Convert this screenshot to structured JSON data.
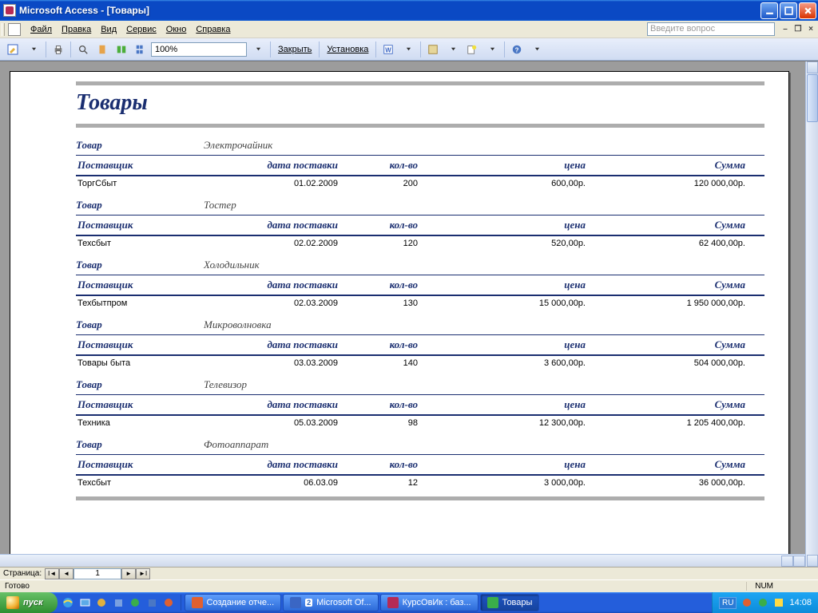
{
  "window": {
    "title": "Microsoft Access - [Товары]"
  },
  "menu": {
    "items": [
      "Файл",
      "Правка",
      "Вид",
      "Сервис",
      "Окно",
      "Справка"
    ],
    "question_placeholder": "Введите вопрос"
  },
  "toolbar": {
    "zoom": "100%",
    "close": "Закрыть",
    "setup": "Установка"
  },
  "navbar": {
    "label": "Страница:",
    "value": "1"
  },
  "status": {
    "ready": "Готово",
    "num": "NUM"
  },
  "report": {
    "title": "Товары",
    "group_label": "Товар",
    "headers": {
      "supplier": "Поставщик",
      "date": "дата поставки",
      "qty": "кол-во",
      "price": "цена",
      "sum": "Сумма"
    },
    "groups": [
      {
        "name": "Электрочайник",
        "rows": [
          {
            "supplier": "ТоргСбыт",
            "date": "01.02.2009",
            "qty": "200",
            "price": "600,00р.",
            "sum": "120 000,00р."
          }
        ]
      },
      {
        "name": "Тостер",
        "rows": [
          {
            "supplier": "Техсбыт",
            "date": "02.02.2009",
            "qty": "120",
            "price": "520,00р.",
            "sum": "62 400,00р."
          }
        ]
      },
      {
        "name": "Холодильник",
        "rows": [
          {
            "supplier": "Техбытпром",
            "date": "02.03.2009",
            "qty": "130",
            "price": "15 000,00р.",
            "sum": "1 950 000,00р."
          }
        ]
      },
      {
        "name": "Микроволновка",
        "rows": [
          {
            "supplier": "Товары быта",
            "date": "03.03.2009",
            "qty": "140",
            "price": "3 600,00р.",
            "sum": "504 000,00р."
          }
        ]
      },
      {
        "name": "Телевизор",
        "rows": [
          {
            "supplier": "Техника",
            "date": "05.03.2009",
            "qty": "98",
            "price": "12 300,00р.",
            "sum": "1 205 400,00р."
          }
        ]
      },
      {
        "name": "Фотоаппарат",
        "rows": [
          {
            "supplier": "Техсбыт",
            "date": "06.03.09",
            "qty": "12",
            "price": "3 000,00р.",
            "sum": "36 000,00р."
          }
        ]
      }
    ]
  },
  "taskbar": {
    "start": "пуск",
    "tasks": [
      {
        "label": "Создание отче...",
        "active": false,
        "color": "#e06030"
      },
      {
        "label": "Microsoft Of...",
        "prefix": "2",
        "active": false,
        "color": "#3a66c4"
      },
      {
        "label": "КурсОвИк : баз...",
        "active": false,
        "color": "#b52b55"
      },
      {
        "label": "Товары",
        "active": true,
        "color": "#3aae4a"
      }
    ],
    "lang": "RU",
    "clock": "14:08"
  }
}
